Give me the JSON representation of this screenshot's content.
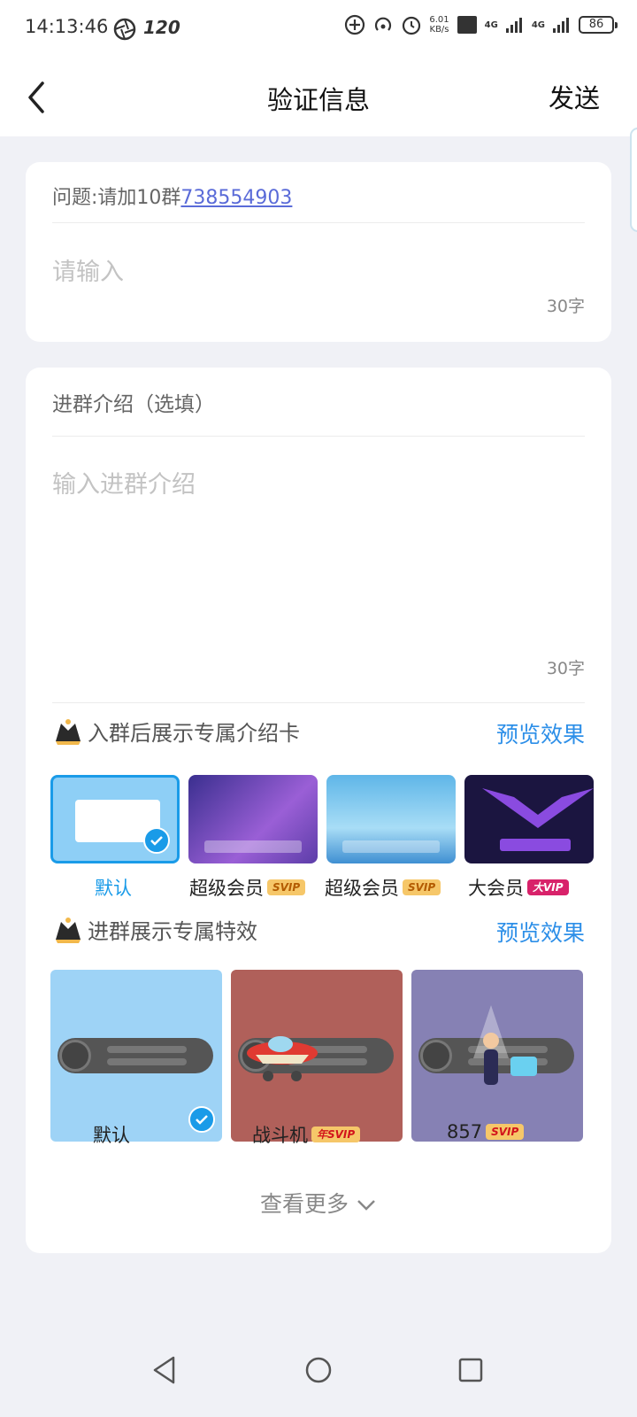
{
  "status_bar": {
    "time": "14:13:46",
    "refresh_rate": "120",
    "net_speed_value": "6.01",
    "net_speed_unit": "KB/s",
    "network_1": "4G",
    "network_2": "4G",
    "battery": "86"
  },
  "nav": {
    "title": "验证信息",
    "send_label": "发送"
  },
  "question": {
    "prefix": "问题:请加10群",
    "link_number": "738554903",
    "answer_placeholder": "请输入",
    "answer_limit": "30字"
  },
  "intro": {
    "section_label": "进群介绍（选填）",
    "placeholder": "输入进群介绍",
    "limit": "30字"
  },
  "intro_cards": {
    "title": "入群后展示专属介绍卡",
    "preview_label": "预览效果",
    "items": [
      {
        "label": "默认",
        "badge": "",
        "selected": true
      },
      {
        "label": "超级会员",
        "badge": "SVIP",
        "selected": false
      },
      {
        "label": "超级会员",
        "badge": "SVIP",
        "selected": false
      },
      {
        "label": "大会员",
        "badge": "大VIP",
        "selected": false
      }
    ]
  },
  "effects": {
    "title": "进群展示专属特效",
    "preview_label": "预览效果",
    "items": [
      {
        "label": "默认",
        "badge": "",
        "selected": true
      },
      {
        "label": "战斗机",
        "badge": "年SVIP",
        "selected": false
      },
      {
        "label": "857",
        "badge": "SVIP",
        "selected": false
      }
    ]
  },
  "more_label": "查看更多",
  "colors": {
    "accent": "#1a9be8",
    "link": "#5a6bd8",
    "preview": "#2d8fe8",
    "background": "#f0f1f6"
  },
  "icons": [
    "back-arrow-icon",
    "crown-icon",
    "check-icon",
    "chevron-down-icon",
    "nav-back-icon",
    "nav-home-icon",
    "nav-recent-icon"
  ]
}
